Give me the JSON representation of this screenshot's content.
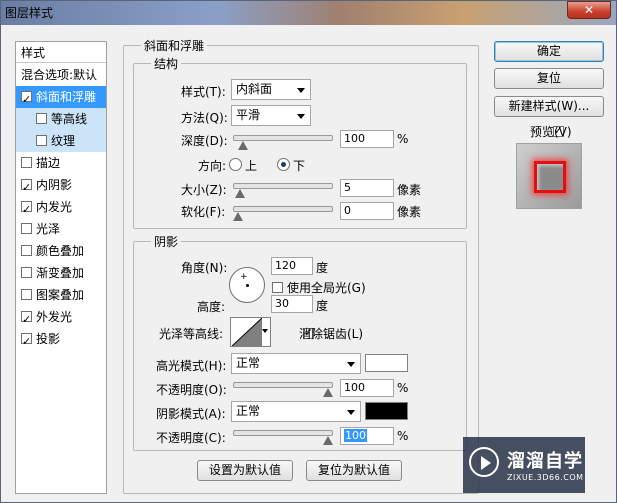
{
  "window": {
    "title": "图层样式",
    "close_label": "✕"
  },
  "left_panel": {
    "header": "样式",
    "items": [
      {
        "label": "混合选项:默认",
        "has_checkbox": false,
        "checked": false,
        "state": "normal"
      },
      {
        "label": "斜面和浮雕",
        "has_checkbox": true,
        "checked": true,
        "state": "selected"
      },
      {
        "label": "等高线",
        "has_checkbox": true,
        "checked": false,
        "state": "sub"
      },
      {
        "label": "纹理",
        "has_checkbox": true,
        "checked": false,
        "state": "sub"
      },
      {
        "label": "描边",
        "has_checkbox": true,
        "checked": false,
        "state": "normal"
      },
      {
        "label": "内阴影",
        "has_checkbox": true,
        "checked": true,
        "state": "normal"
      },
      {
        "label": "内发光",
        "has_checkbox": true,
        "checked": true,
        "state": "normal"
      },
      {
        "label": "光泽",
        "has_checkbox": true,
        "checked": false,
        "state": "normal"
      },
      {
        "label": "颜色叠加",
        "has_checkbox": true,
        "checked": false,
        "state": "normal"
      },
      {
        "label": "渐变叠加",
        "has_checkbox": true,
        "checked": false,
        "state": "normal"
      },
      {
        "label": "图案叠加",
        "has_checkbox": true,
        "checked": false,
        "state": "normal"
      },
      {
        "label": "外发光",
        "has_checkbox": true,
        "checked": true,
        "state": "normal"
      },
      {
        "label": "投影",
        "has_checkbox": true,
        "checked": true,
        "state": "normal"
      }
    ]
  },
  "bevel": {
    "section_title": "斜面和浮雕",
    "structure": {
      "title": "结构",
      "style_label": "样式(T):",
      "style_value": "内斜面",
      "technique_label": "方法(Q):",
      "technique_value": "平滑",
      "depth_label": "深度(D):",
      "depth_value": "100",
      "depth_fraction": 0.06,
      "depth_unit": "%",
      "direction_label": "方向:",
      "direction_up": "上",
      "direction_down": "下",
      "direction_selected": "down",
      "size_label": "大小(Z):",
      "size_value": "5",
      "size_fraction": 0.02,
      "size_unit": "像素",
      "soften_label": "软化(F):",
      "soften_value": "0",
      "soften_fraction": 0.0,
      "soften_unit": "像素"
    },
    "shading": {
      "title": "阴影",
      "angle_label": "角度(N):",
      "angle_value": "120",
      "angle_unit": "度",
      "global_light_label": "使用全局光(G)",
      "global_light_checked": false,
      "altitude_label": "高度:",
      "altitude_value": "30",
      "altitude_unit": "度",
      "gloss_contour_label": "光泽等高线:",
      "anti_alias_label": "消除锯齿(L)",
      "anti_alias_checked": true,
      "highlight_mode_label": "高光模式(H):",
      "highlight_mode_value": "正常",
      "highlight_color": "#ffffff",
      "highlight_opacity_label": "不透明度(O):",
      "highlight_opacity_value": "100",
      "highlight_opacity_fraction": 1.0,
      "highlight_opacity_unit": "%",
      "shadow_mode_label": "阴影模式(A):",
      "shadow_mode_value": "正常",
      "shadow_color": "#000000",
      "shadow_opacity_label": "不透明度(C):",
      "shadow_opacity_value": "100",
      "shadow_opacity_fraction": 1.0,
      "shadow_opacity_unit": "%"
    },
    "make_default_label": "设置为默认值",
    "reset_default_label": "复位为默认值"
  },
  "actions": {
    "ok_label": "确定",
    "reset_label": "复位",
    "new_style_label": "新建样式(W)...",
    "preview_label": "预览(V)",
    "preview_checked": true
  },
  "watermark": {
    "name": "溜溜自学",
    "url": "ZIXUE.3D66.COM"
  }
}
